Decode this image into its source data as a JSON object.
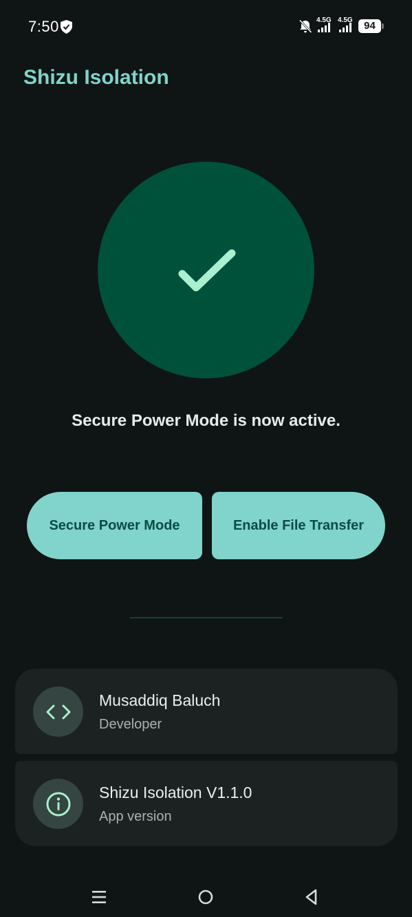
{
  "status_bar": {
    "time": "7:50",
    "net1": "4.5G",
    "net2": "4.5G",
    "battery": "94"
  },
  "header": {
    "title": "Shizu Isolation"
  },
  "status": {
    "message": "Secure Power Mode is now active."
  },
  "buttons": {
    "secure_power_mode": "Secure Power Mode",
    "enable_file_transfer": "Enable File Transfer"
  },
  "cards": {
    "developer": {
      "title": "Musaddiq Baluch",
      "subtitle": "Developer",
      "icon": "code-icon"
    },
    "version": {
      "title": "Shizu Isolation V1.1.0",
      "subtitle": "App version",
      "icon": "info-icon"
    }
  },
  "colors": {
    "background": "#0f1514",
    "accent": "#80d4cb",
    "title": "#7fd4cb",
    "status_circle": "#00513a",
    "check": "#a8f0cf",
    "card": "#1c2221"
  }
}
